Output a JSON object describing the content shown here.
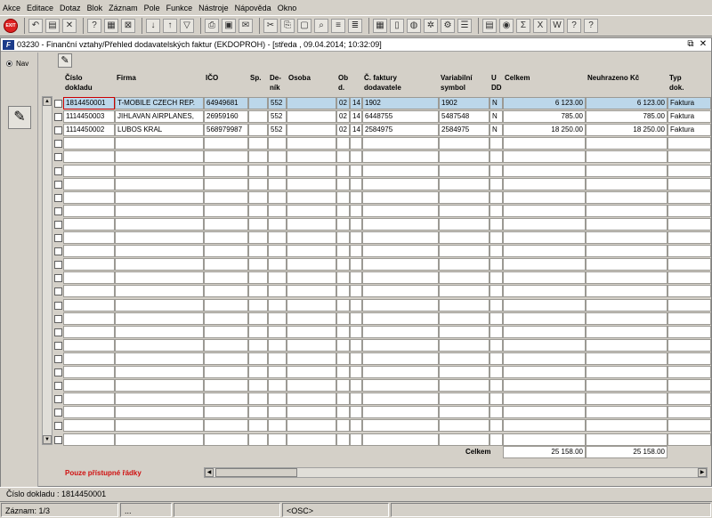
{
  "menu": [
    "Akce",
    "Editace",
    "Dotaz",
    "Blok",
    "Záznam",
    "Pole",
    "Funkce",
    "Nástroje",
    "Nápověda",
    "Okno"
  ],
  "toolbar": {
    "exit_label": "EXIT"
  },
  "window": {
    "title": "03230 - Finanční vztahy/Přehled dodavatelských faktur (EKDOPROH) - [středa , 09.04.2014; 10:32:09]",
    "logo": "F"
  },
  "left": {
    "nav_label": "Nav"
  },
  "columns": {
    "cislo": "Číslo\ndokladu",
    "firma": "Firma",
    "ico": "IČO",
    "sp": "Sp.",
    "denik": "De-\nník",
    "osoba": "Osoba",
    "obd": "Ob\nd.",
    "cfak": "Č. faktury\ndodavatele",
    "vs": "Variabilní\nsymbol",
    "udd": "U\nDD",
    "celkem": "Celkem",
    "neuhr": "Neuhrazeno Kč",
    "typ": "Typ\ndok."
  },
  "rows": [
    {
      "cislo": "1814450001",
      "firma": "T-MOBILE CZECH REP.",
      "ico": "64949681",
      "sp": "",
      "denik": "552",
      "osoba": "",
      "ob1": "02",
      "ob2": "14",
      "cfak": "1902",
      "vs": "1902",
      "udd": "N",
      "celkem": "6 123.00",
      "neuhr": "6 123.00",
      "typ": "Faktura"
    },
    {
      "cislo": "1114450003",
      "firma": "JIHLAVAN AIRPLANES,",
      "ico": "26959160",
      "sp": "",
      "denik": "552",
      "osoba": "",
      "ob1": "02",
      "ob2": "14",
      "cfak": "6448755",
      "vs": "5487548",
      "udd": "N",
      "celkem": "785.00",
      "neuhr": "785.00",
      "typ": "Faktura"
    },
    {
      "cislo": "1114450002",
      "firma": "LUBOS KRAL",
      "ico": "568979987",
      "sp": "",
      "denik": "552",
      "osoba": "",
      "ob1": "02",
      "ob2": "14",
      "cfak": "2584975",
      "vs": "2584975",
      "udd": "N",
      "celkem": "18 250.00",
      "neuhr": "18 250.00",
      "typ": "Faktura"
    }
  ],
  "totals": {
    "label": "Celkem",
    "celkem": "25 158.00",
    "neuhr": "25 158.00"
  },
  "only_accessible": "Pouze přístupné řádky",
  "status": {
    "line1": "Číslo dokladu : 1814450001",
    "zaznam": "Záznam: 1/3",
    "dots": "...",
    "osc": "<OSC>"
  }
}
